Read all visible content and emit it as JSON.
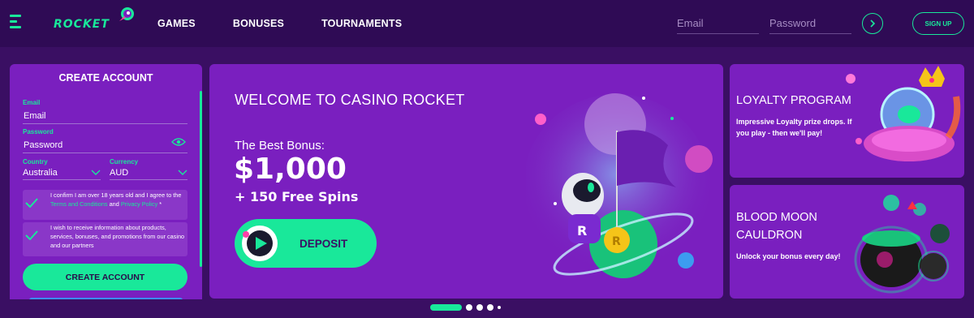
{
  "header": {
    "logo_text": "ROCKET",
    "nav": [
      "GAMES",
      "BONUSES",
      "TOURNAMENTS"
    ],
    "email_placeholder": "Email",
    "password_placeholder": "Password",
    "signup_label": "SIGN UP"
  },
  "signup_form": {
    "title": "CREATE ACCOUNT",
    "email_label": "Email",
    "email_value": "Email",
    "password_label": "Password",
    "password_value": "Password",
    "country_label": "Country",
    "country_value": "Australia",
    "currency_label": "Currency",
    "currency_value": "AUD",
    "age_text_1": "I confirm I am over 18 years old and I agree to the ",
    "age_terms_link": "Terms and Conditions",
    "age_text_2": " and ",
    "age_privacy_link": "Privacy Policy",
    "age_text_3": " *",
    "marketing_text": "I wish to receive information about products, services, bonuses, and promotions from our casino and our partners",
    "create_label": "CREATE ACCOUNT"
  },
  "hero": {
    "title": "WELCOME TO CASINO ROCKET",
    "subtitle": "The Best Bonus:",
    "amount": "$1,000",
    "spins": "+ 150 Free Spins",
    "deposit_label": "DEPOSIT"
  },
  "promos": [
    {
      "title": "LOYALTY PROGRAM",
      "text": "Impressive Loyalty prize drops. If you play - then we'll pay!"
    },
    {
      "title": "BLOOD MOON CAULDRON",
      "text": "Unlock your bonus every day!"
    }
  ],
  "carousel": {
    "dots": 4,
    "active": 0
  },
  "colors": {
    "accent": "#19e89a",
    "background": "#3a0f63",
    "card": "#7a1fbf"
  }
}
